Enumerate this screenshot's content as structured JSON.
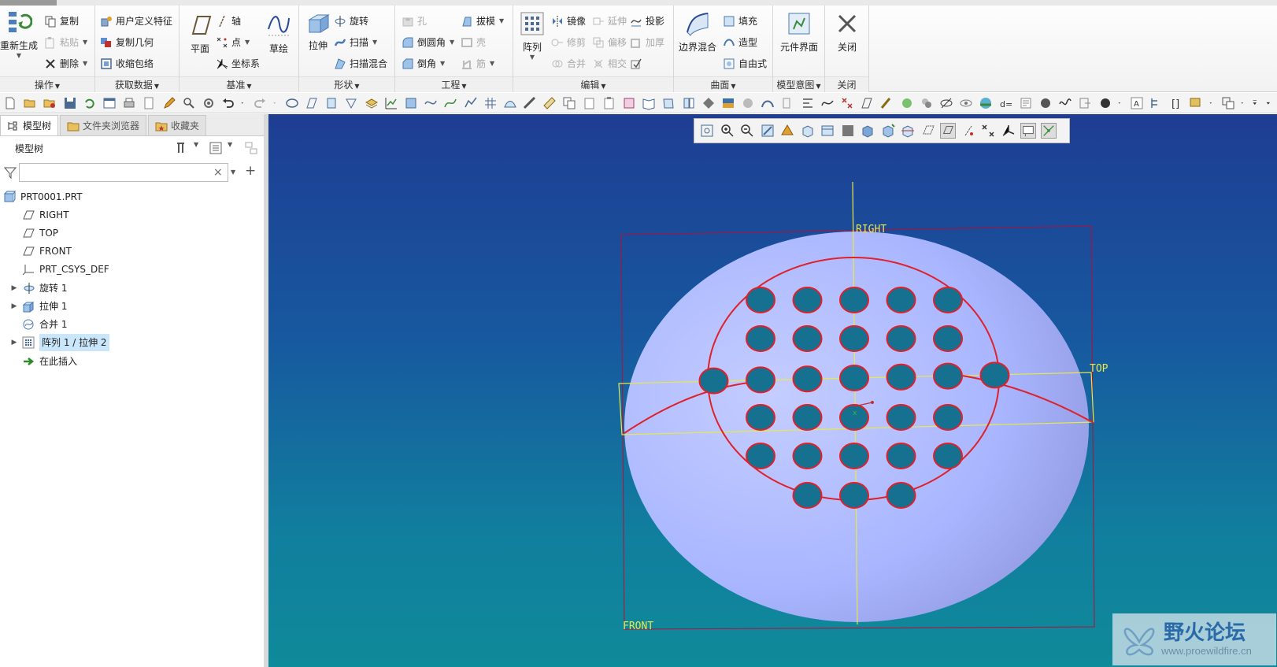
{
  "ribbon": {
    "groups": [
      {
        "label": "操作"
      },
      {
        "label": "获取数据"
      },
      {
        "label": "基准"
      },
      {
        "label": "形状"
      },
      {
        "label": "工程"
      },
      {
        "label": "编辑"
      },
      {
        "label": "曲面"
      },
      {
        "label": "模型意图"
      },
      {
        "label": "关闭"
      }
    ],
    "operations": {
      "regenerate": "重新生成",
      "copy": "复制",
      "paste": "粘贴",
      "delete": "删除"
    },
    "get_data": {
      "udf": "用户定义特征",
      "copy_geom": "复制几何",
      "shrinkwrap": "收缩包络"
    },
    "datum": {
      "plane": "平面",
      "axis": "轴",
      "point": "点",
      "csys": "坐标系",
      "sketch": "草绘"
    },
    "shapes": {
      "extrude": "拉伸",
      "revolve": "旋转",
      "sweep": "扫描",
      "swept_blend": "扫描混合"
    },
    "engineering": {
      "hole": "孔",
      "draft": "拔模",
      "round": "倒圆角",
      "shell": "壳",
      "chamfer": "倒角",
      "rib": "筋"
    },
    "editing": {
      "pattern": "阵列",
      "mirror": "镜像",
      "extend": "延伸",
      "project": "投影",
      "trim": "修剪",
      "offset": "偏移",
      "thicken": "加厚",
      "merge": "合并",
      "intersect": "相交"
    },
    "surfaces": {
      "boundary_blend": "边界混合",
      "fill": "填充",
      "style": "造型",
      "freestyle": "自由式"
    },
    "model_intent": {
      "component_interface": "元件界面"
    },
    "close": {
      "close": "关闭"
    }
  },
  "left_panel": {
    "tabs": {
      "model_tree": "模型树",
      "folder_browser": "文件夹浏览器",
      "favorites": "收藏夹"
    },
    "header": "模型树",
    "search": {
      "value": "",
      "placeholder": ""
    },
    "tree": [
      {
        "label": "PRT0001.PRT",
        "icon": "part-icon",
        "expandable": false,
        "selected": false
      },
      {
        "label": "RIGHT",
        "icon": "datum-plane-icon",
        "expandable": false,
        "selected": false
      },
      {
        "label": "TOP",
        "icon": "datum-plane-icon",
        "expandable": false,
        "selected": false
      },
      {
        "label": "FRONT",
        "icon": "datum-plane-icon",
        "expandable": false,
        "selected": false
      },
      {
        "label": "PRT_CSYS_DEF",
        "icon": "csys-icon",
        "expandable": false,
        "selected": false
      },
      {
        "label": "旋转 1",
        "icon": "revolve-icon",
        "expandable": true,
        "selected": false
      },
      {
        "label": "拉伸 1",
        "icon": "extrude-icon",
        "expandable": true,
        "selected": false
      },
      {
        "label": "合并 1",
        "icon": "merge-icon",
        "expandable": false,
        "selected": false
      },
      {
        "label": "阵列 1 / 拉伸 2",
        "icon": "pattern-icon",
        "expandable": true,
        "selected": true
      },
      {
        "label": "在此插入",
        "icon": "insert-here-arrow-icon",
        "expandable": false,
        "selected": false
      }
    ]
  },
  "viewport": {
    "datum_labels": {
      "right": "RIGHT",
      "top": "TOP",
      "front": "FRONT"
    },
    "colors": {
      "dome": "#a9b6ff",
      "curves": "#e0202a",
      "datum": "#e8e84a",
      "holes": "#167090"
    },
    "pattern": {
      "rows": [
        5,
        5,
        7,
        5,
        5,
        3
      ]
    },
    "watermark": {
      "title": "野火论坛",
      "url": "www.proewildfire.cn"
    }
  }
}
